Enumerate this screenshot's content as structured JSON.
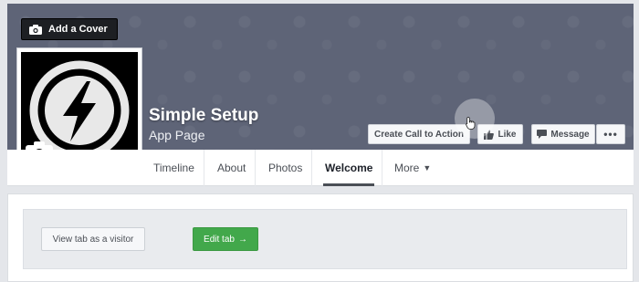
{
  "cover": {
    "add_cover_label": "Add a Cover",
    "background_color": "#5e6477"
  },
  "profile": {
    "page_name": "Simple Setup",
    "category": "App Page",
    "logo_icon": "lightning-bolt-circle-icon",
    "camera_icon": "camera-icon"
  },
  "actions": {
    "call_to_action": "Create Call to Action",
    "like": "Like",
    "message": "Message",
    "more": "•••"
  },
  "tabs": [
    {
      "label": "Timeline"
    },
    {
      "label": "About"
    },
    {
      "label": "Photos"
    },
    {
      "label": "Welcome",
      "active": true
    },
    {
      "label": "More"
    }
  ],
  "welcome_tab": {
    "view_as_visitor": "View tab as a visitor",
    "edit_tab": "Edit tab",
    "edit_arrow": "→",
    "edit_color": "#42a84b"
  }
}
